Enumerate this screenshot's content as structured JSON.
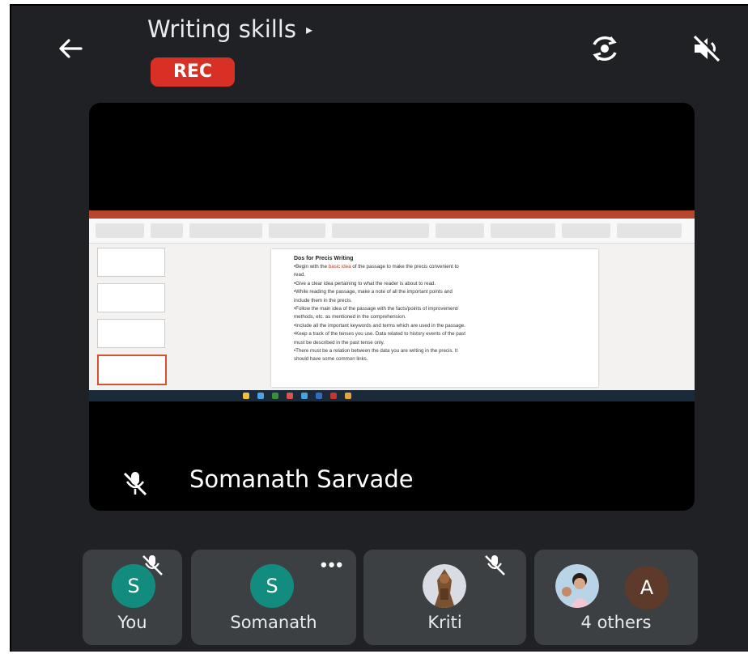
{
  "meeting": {
    "title": "Writing skills",
    "title_arrow": "▸",
    "rec_label": "REC",
    "colors": {
      "background": "#202124",
      "rec": "#d93025",
      "tile": "#3c4043",
      "avatar_teal": "#128c7e",
      "avatar_brown": "#5d3a2a"
    }
  },
  "toolbar": {
    "back_icon": "arrow-left-icon",
    "switch_camera_icon": "camera-switch-icon",
    "speaker_off_icon": "volume-off-icon"
  },
  "main_tile": {
    "presenter_name": "Somanath Sarvade",
    "mic_icon": "mic-off-icon",
    "slide": {
      "title": "Dos for Precis Writing",
      "lines": [
        {
          "pre": "•Begin with the ",
          "hl": "basic idea",
          "post": " of the passage to make the precis convenient to"
        },
        {
          "pre": "read.",
          "hl": "",
          "post": ""
        },
        {
          "pre": "•Give a clear idea pertaining to what the reader is about to read.",
          "hl": "",
          "post": ""
        },
        {
          "pre": "•While reading the passage, make a note of all the important points and",
          "hl": "",
          "post": ""
        },
        {
          "pre": "include them in the precis.",
          "hl": "",
          "post": ""
        },
        {
          "pre": "•Follow the main idea of the passage with the facts/points of improvement/",
          "hl": "",
          "post": ""
        },
        {
          "pre": "methods, etc. as mentioned in the comprehension.",
          "hl": "",
          "post": ""
        },
        {
          "pre": "•Include all the important keywords and terms which are used in the passage.",
          "hl": "",
          "post": ""
        },
        {
          "pre": "•Keep a track of the tenses you use. Data related to history events of the past",
          "hl": "",
          "post": ""
        },
        {
          "pre": "must be described in the past tense only.",
          "hl": "",
          "post": ""
        },
        {
          "pre": "•There must be a relation between the data you are writing in the precis. It",
          "hl": "",
          "post": ""
        },
        {
          "pre": "should have some common links.",
          "hl": "",
          "post": ""
        }
      ]
    }
  },
  "participants": [
    {
      "name": "You",
      "avatar_letter": "S",
      "avatar_color": "#128c7e",
      "muted": true,
      "more": false
    },
    {
      "name": "Somanath",
      "avatar_letter": "S",
      "avatar_color": "#128c7e",
      "muted": false,
      "more": true,
      "more_label": "•••"
    },
    {
      "name": "Kriti",
      "avatar_letter": "",
      "avatar_color": "#8a6a4a",
      "muted": true,
      "more": false
    },
    {
      "name": "4 others",
      "avatar_letter": "A",
      "avatar_color": "#5d3a2a",
      "muted": false,
      "more": false
    }
  ]
}
